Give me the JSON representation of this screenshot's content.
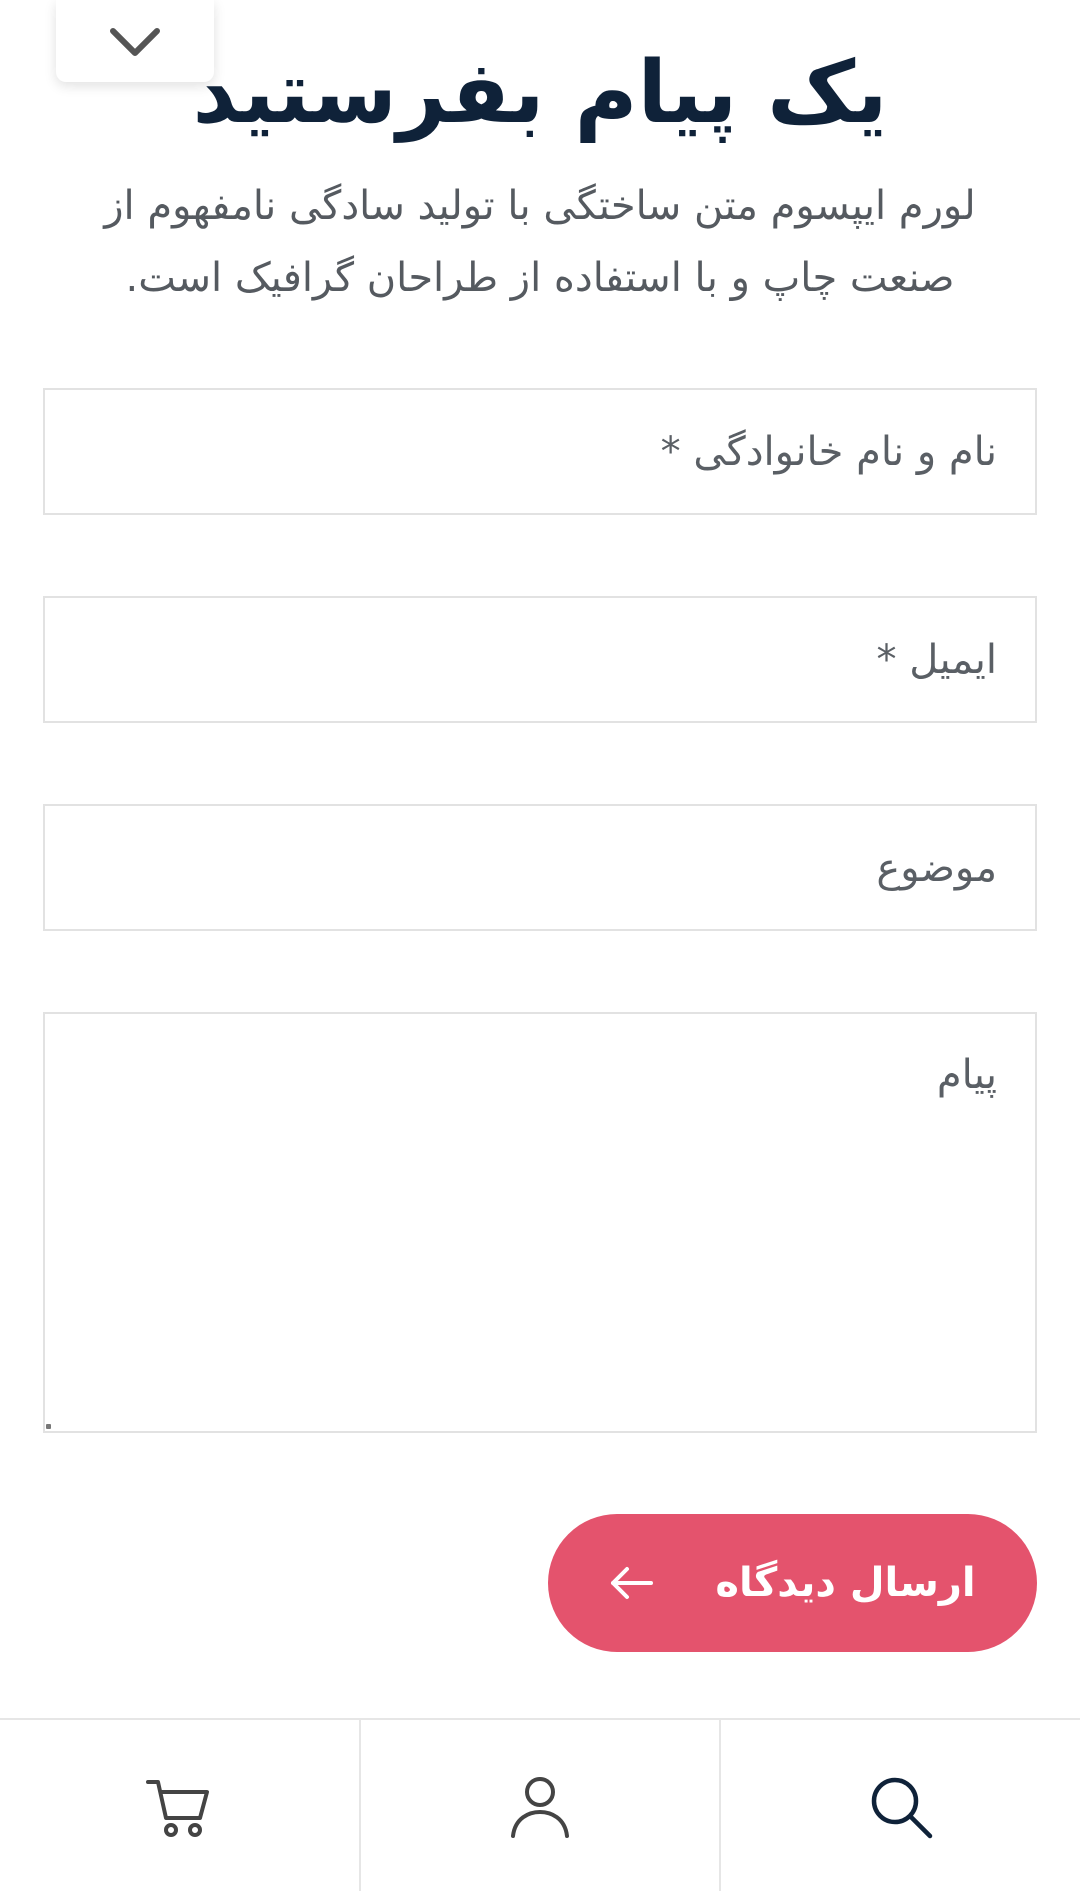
{
  "header": {
    "title": "یک پیام بفرستید",
    "subtitle": "لورم ایپسوم متن ساختگی با تولید سادگی نامفهوم از صنعت چاپ و با استفاده از طراحان گرافیک است."
  },
  "form": {
    "name_placeholder": "نام و نام خانوادگی *",
    "email_placeholder": "ایمیل *",
    "subject_placeholder": "موضوع",
    "message_placeholder": "پیام",
    "submit_label": "ارسال دیدگاه"
  },
  "icons": {
    "collapse": "chevron-down-icon",
    "submit": "arrow-left-icon",
    "nav_cart": "cart-icon",
    "nav_account": "user-icon",
    "nav_search": "search-icon"
  },
  "colors": {
    "title": "#0f2239",
    "accent": "#e4536d",
    "text": "#555a60"
  }
}
